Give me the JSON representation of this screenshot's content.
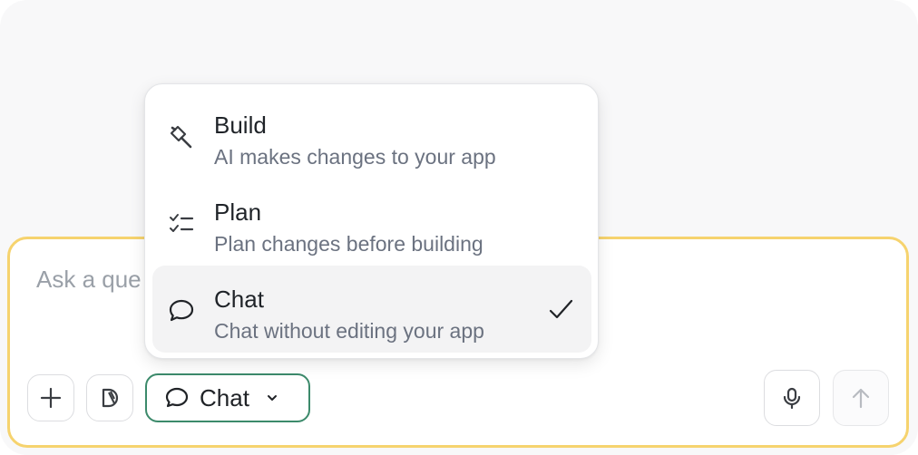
{
  "composer": {
    "placeholder": "Ask a que"
  },
  "mode_selector": {
    "current_label": "Chat"
  },
  "mode_menu": {
    "items": [
      {
        "title": "Build",
        "description": "AI makes changes to your app",
        "icon": "hammer-icon",
        "selected": false
      },
      {
        "title": "Plan",
        "description": "Plan changes before building",
        "icon": "checklist-icon",
        "selected": false
      },
      {
        "title": "Chat",
        "description": "Chat without editing your app",
        "icon": "chat-bubble-icon",
        "selected": true
      }
    ]
  },
  "toolbar": {
    "icons": [
      "plus-icon",
      "toggle-icon",
      "chat-bubble-icon",
      "chevron-down-icon",
      "microphone-icon",
      "arrow-up-icon"
    ]
  },
  "colors": {
    "composer_border": "#f6d36e",
    "mode_button_border": "#3c8a6b",
    "selected_item_bg": "#f3f3f4"
  }
}
